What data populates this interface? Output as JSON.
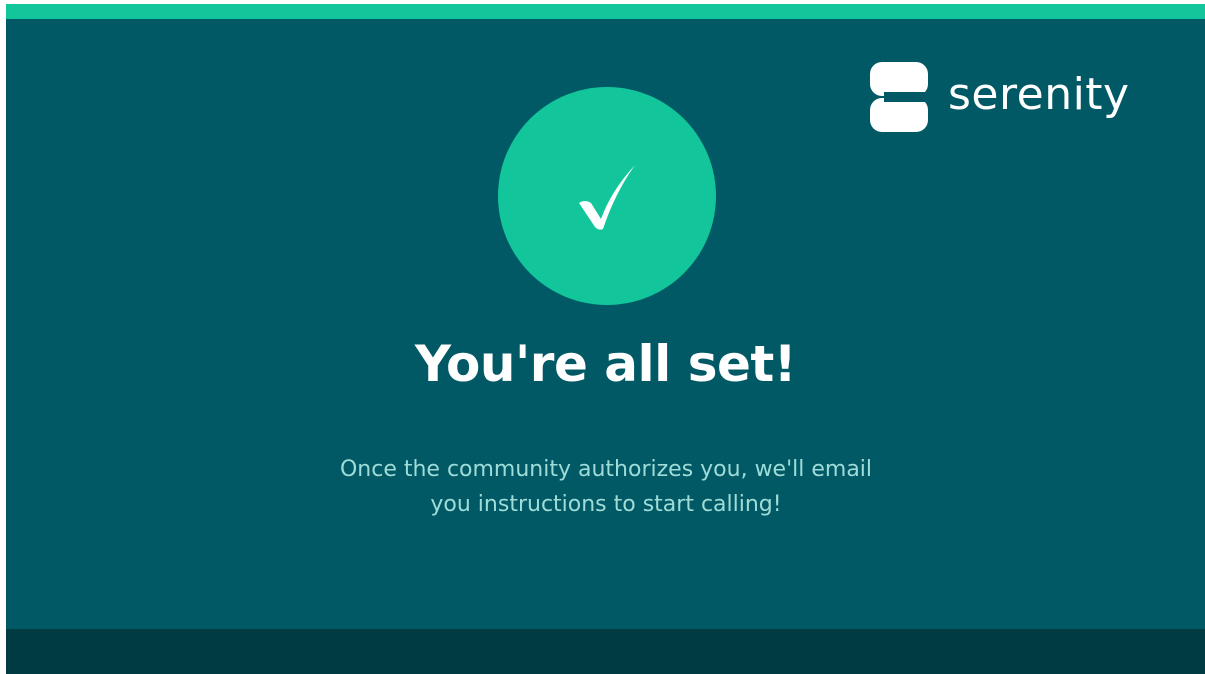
{
  "brand": {
    "name": "serenity",
    "logo_icon": "serenity-s-logo-icon"
  },
  "status": {
    "icon": "checkmark-icon",
    "title": "You're all set!",
    "message_line1": "Once the community authorizes you, we'll email",
    "message_line2": "you instructions to start calling!"
  },
  "colors": {
    "background": "#005964",
    "accent": "#12c59a",
    "footer": "#003a43",
    "message_text": "#9fdcd8",
    "heading_text": "#ffffff"
  }
}
